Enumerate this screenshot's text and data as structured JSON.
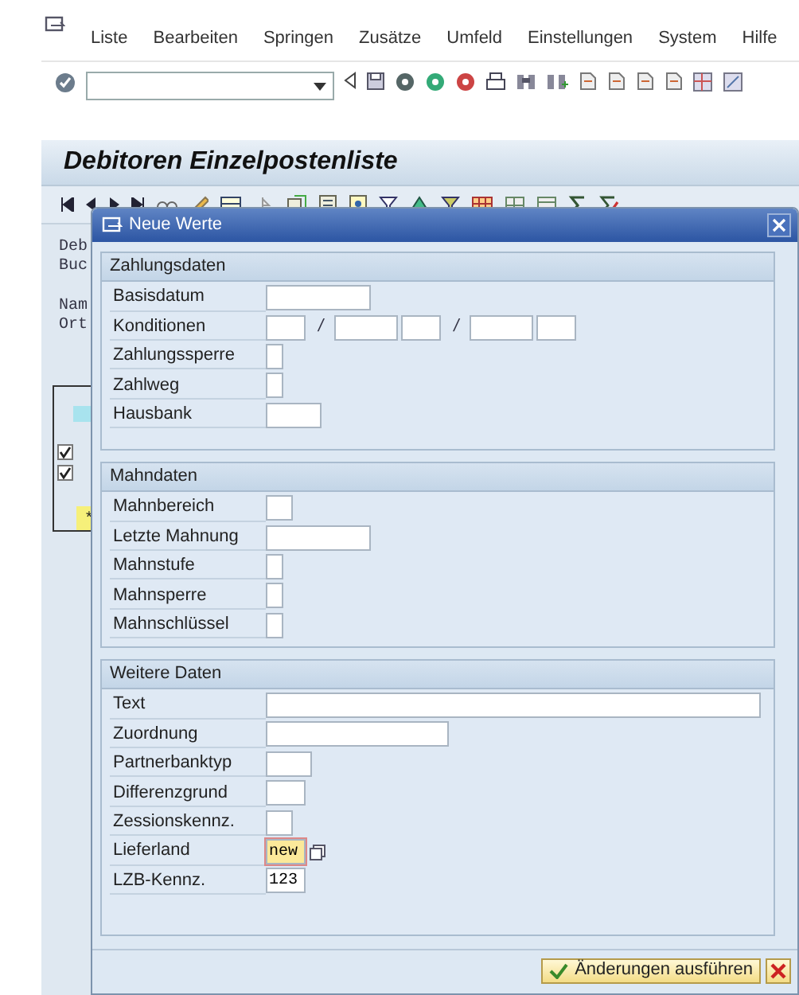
{
  "menu_bar": {
    "items": [
      "Liste",
      "Bearbeiten",
      "Springen",
      "Zusätze",
      "Umfeld",
      "Einstellungen",
      "System",
      "Hilfe"
    ]
  },
  "screen_title": "Debitoren Einzelpostenliste",
  "header_lines": [
    "Deb",
    "Buc",
    "Nam",
    "Ort"
  ],
  "list_fragment": {
    "rows": [
      {
        "checked": true
      },
      {
        "checked": true
      }
    ],
    "total_mark": "*"
  },
  "dialog": {
    "title": "Neue Werte",
    "groups": [
      {
        "title": "Zahlungsdaten",
        "fields": [
          {
            "label": "Basisdatum",
            "inputs": [
              {
                "kind": "date"
              }
            ]
          },
          {
            "label": "Konditionen",
            "inputs": [
              {
                "kind": "short"
              },
              {
                "kind": "sep",
                "text": "/"
              },
              {
                "kind": "days"
              },
              {
                "kind": "short"
              },
              {
                "kind": "sep",
                "text": "/"
              },
              {
                "kind": "days"
              },
              {
                "kind": "short"
              }
            ]
          },
          {
            "label": "Zahlungssperre",
            "inputs": [
              {
                "kind": "flag"
              }
            ]
          },
          {
            "label": "Zahlweg",
            "inputs": [
              {
                "kind": "flag"
              }
            ]
          },
          {
            "label": "Hausbank",
            "inputs": [
              {
                "kind": "bank"
              }
            ]
          }
        ]
      },
      {
        "title": "Mahndaten",
        "fields": [
          {
            "label": "Mahnbereich",
            "inputs": [
              {
                "kind": "code"
              }
            ]
          },
          {
            "label": "Letzte Mahnung",
            "inputs": [
              {
                "kind": "date"
              }
            ]
          },
          {
            "label": "Mahnstufe",
            "inputs": [
              {
                "kind": "flag"
              }
            ]
          },
          {
            "label": "Mahnsperre",
            "inputs": [
              {
                "kind": "flag"
              }
            ]
          },
          {
            "label": "Mahnschlüssel",
            "inputs": [
              {
                "kind": "flag"
              }
            ]
          }
        ]
      },
      {
        "title": "Weitere Daten",
        "fields": [
          {
            "label": "Text",
            "inputs": [
              {
                "kind": "text"
              }
            ]
          },
          {
            "label": "Zuordnung",
            "inputs": [
              {
                "kind": "assignment"
              }
            ]
          },
          {
            "label": "Partnerbanktyp",
            "inputs": [
              {
                "kind": "type"
              }
            ]
          },
          {
            "label": "Differenzgrund",
            "inputs": [
              {
                "kind": "short"
              }
            ]
          },
          {
            "label": "Zessionskennz.",
            "inputs": [
              {
                "kind": "code"
              }
            ]
          },
          {
            "label": "Lieferland",
            "inputs": [
              {
                "kind": "short",
                "value": "new",
                "focused": true,
                "value_help": true
              }
            ]
          },
          {
            "label": "LZB-Kennz.",
            "inputs": [
              {
                "kind": "short",
                "value": "123"
              }
            ]
          }
        ]
      }
    ],
    "confirm_button": "Änderungen ausführen"
  }
}
